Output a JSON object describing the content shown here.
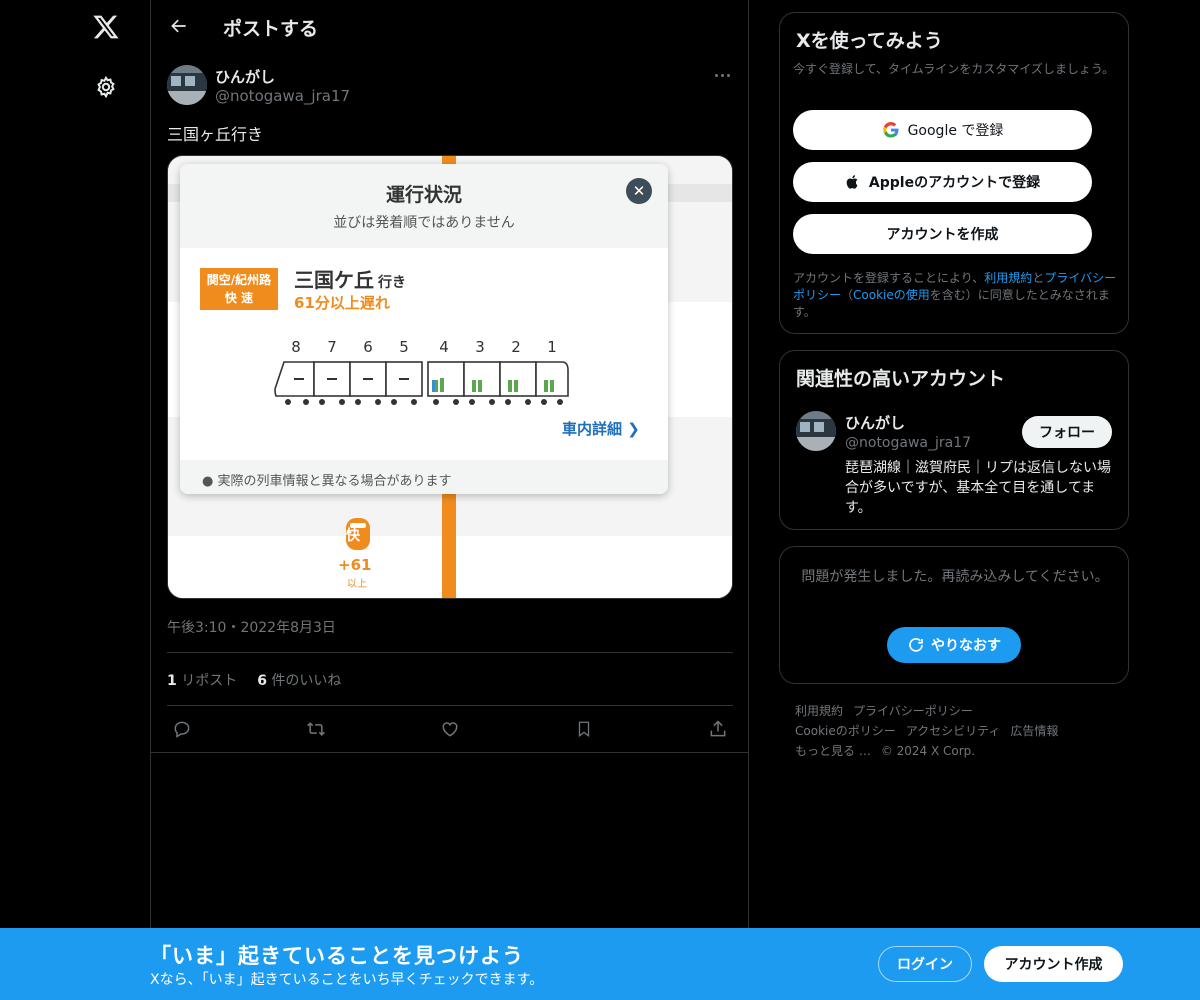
{
  "nav": {
    "logo_icon": "x-logo-icon",
    "settings_icon": "gear-icon"
  },
  "header": {
    "title": "ポストする"
  },
  "post": {
    "author_name": "ひんがし",
    "author_handle": "@notogawa_jra17",
    "text": "三国ヶ丘行き",
    "timestamp": "午後3:10・2022年8月3日",
    "reposts_count": "1",
    "reposts_label": "リポスト",
    "likes_count": "6",
    "likes_label": "件のいいね",
    "media": {
      "title": "運行状況",
      "subtitle": "並びは発着順ではありません",
      "badge_line1": "関空/紀州路",
      "badge_line2": "快 速",
      "destination": "三国ケ丘",
      "destination_suffix": "行き",
      "delay": "61分以上遅れ",
      "car_numbers": [
        "8",
        "7",
        "6",
        "5",
        "4",
        "3",
        "2",
        "1"
      ],
      "detail_link": "車内詳細",
      "note": "実際の列車情報と異なる場合があります",
      "marker_label": "快",
      "marker_delay": "+61",
      "marker_delay_sub": "以上",
      "accent_color": "#f08c1e"
    }
  },
  "signup": {
    "title": "Xを使ってみよう",
    "subtitle": "今すぐ登録して、タイムラインをカスタマイズしましょう。",
    "google_label": "Google で登録",
    "apple_label": "Appleのアカウントで登録",
    "create_label": "アカウントを作成",
    "legal_1": "アカウントを登録することにより、",
    "legal_terms": "利用規約",
    "legal_2": "と",
    "legal_privacy": "プライバシーポリシー",
    "legal_3": "（",
    "legal_cookie": "Cookieの使用",
    "legal_4": "を含む）に同意したとみなされます。"
  },
  "related": {
    "title": "関連性の高いアカウント",
    "name": "ひんがし",
    "handle": "@notogawa_jra17",
    "bio": "琵琶湖線｜滋賀府民｜リプは返信しない場合が多いですが、基本全て目を通してます。",
    "follow_label": "フォロー"
  },
  "error": {
    "text": "問題が発生しました。再読み込みしてください。",
    "retry_label": "やりなおす"
  },
  "footer": {
    "links": [
      "利用規約",
      "プライバシーポリシー",
      "Cookieのポリシー",
      "アクセシビリティ",
      "広告情報",
      "もっと見る …",
      "© 2024 X Corp."
    ]
  },
  "banner": {
    "title": "「いま」起きていることを見つけよう",
    "subtitle": "Xなら、「いま」起きていることをいち早くチェックできます。",
    "login_label": "ログイン",
    "signup_label": "アカウント作成"
  },
  "colors": {
    "accent": "#1d9bf0",
    "background": "#000000",
    "border": "#2f3336",
    "muted": "#71767b"
  }
}
